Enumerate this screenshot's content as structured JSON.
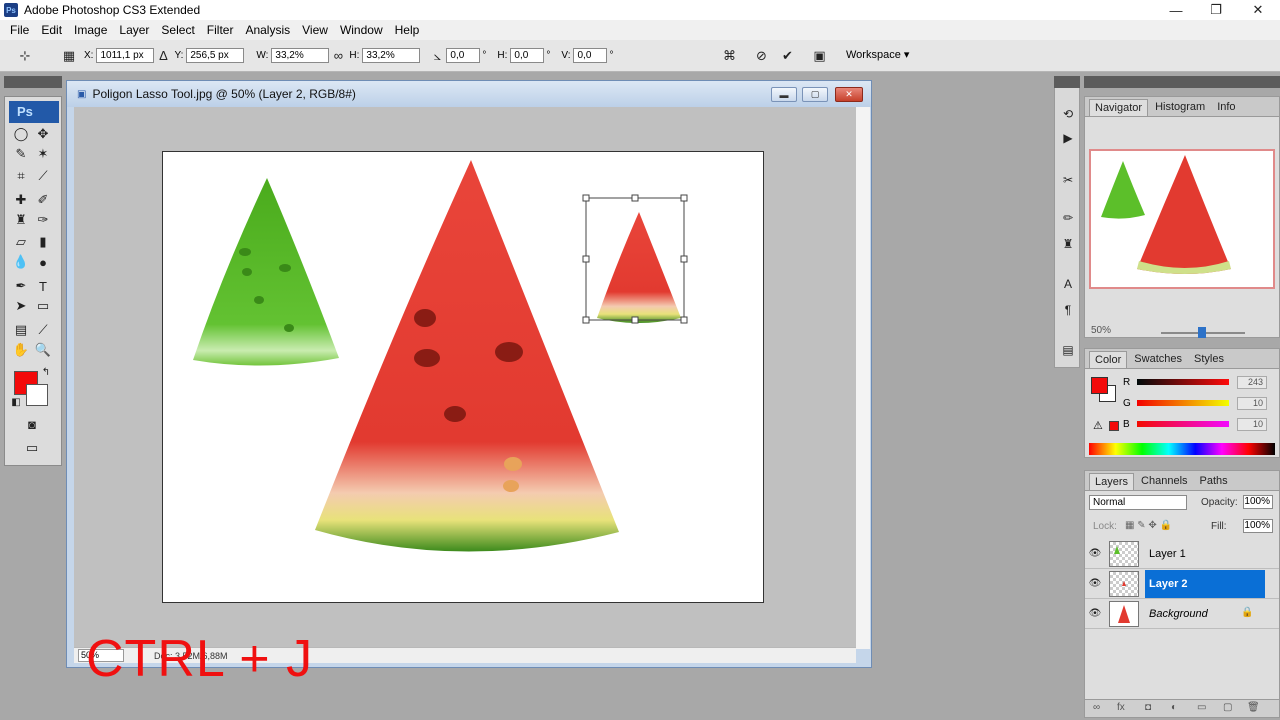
{
  "app": {
    "title": "Adobe Photoshop CS3 Extended",
    "icon_label": "Ps"
  },
  "window_controls": {
    "minimize": "—",
    "restore": "❐",
    "close": "✕"
  },
  "menu": [
    "File",
    "Edit",
    "Image",
    "Layer",
    "Select",
    "Filter",
    "Analysis",
    "View",
    "Window",
    "Help"
  ],
  "options": {
    "x_label": "X:",
    "x_value": "1011,1 px",
    "y_label": "Y:",
    "y_value": "256,5 px",
    "w_label": "W:",
    "w_value": "33,2%",
    "h_label": "H:",
    "h_value": "33,2%",
    "angle_value": "0,0",
    "hskew_label": "H:",
    "hskew_value": "0,0",
    "vskew_label": "V:",
    "vskew_value": "0,0",
    "degree": "°",
    "workspace": "Workspace ▾"
  },
  "toolbox": {
    "logo": "Ps"
  },
  "document": {
    "title": "Poligon Lasso Tool.jpg @ 50% (Layer 2, RGB/8#)",
    "zoom": "50%",
    "info": "Doc: 3,52M/6,88M"
  },
  "overlay": {
    "shortcut": "CTRL + J"
  },
  "navigator": {
    "tabs": [
      "Navigator",
      "Histogram",
      "Info"
    ],
    "zoom": "50%"
  },
  "color_panel": {
    "tabs": [
      "Color",
      "Swatches",
      "Styles"
    ],
    "channels": [
      {
        "label": "R",
        "value": "243"
      },
      {
        "label": "G",
        "value": "10"
      },
      {
        "label": "B",
        "value": "10"
      }
    ],
    "foreground": "#f30a0a"
  },
  "layers_panel": {
    "tabs": [
      "Layers",
      "Channels",
      "Paths"
    ],
    "blend_mode": "Normal",
    "opacity_label": "Opacity:",
    "opacity": "100%",
    "lock_label": "Lock:",
    "fill_label": "Fill:",
    "fill": "100%",
    "layers": [
      {
        "name": "Layer 1",
        "selected": false
      },
      {
        "name": "Layer 2",
        "selected": true
      },
      {
        "name": "Background",
        "selected": false
      }
    ]
  },
  "colors": {
    "accent": "#0a6fd6",
    "shortcut": "#f01010",
    "watermelon_red": "#e23a30",
    "green_slice": "#5cbf2a"
  }
}
